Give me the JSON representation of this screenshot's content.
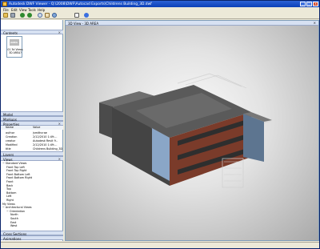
{
  "window": {
    "title": "Autodesk DWF Viewer - Q:\\2008\\DWF\\Autocad Exports\\Childrens Building_3D.dwf",
    "minimize": "_",
    "maximize": "□",
    "close": "x"
  },
  "menu": [
    "File",
    "Edit",
    "View",
    "Tools",
    "Help"
  ],
  "toolbar": {
    "icons": [
      "open-icon",
      "print-icon",
      "back-icon",
      "forward-icon",
      "zoom-icon",
      "pan-icon",
      "orbit-icon",
      "select-icon",
      "help-icon"
    ]
  },
  "contents": {
    "header": "Contents",
    "thumbnail_label": "01 3d Views 3D AREA?",
    "thumbnail_badge": "AREA"
  },
  "sections": {
    "model": "Model",
    "markups": "Markups",
    "properties": "Properties",
    "layers": "Layers",
    "views": "Views",
    "cross_sections": "Cross Sections",
    "animations": "Animations"
  },
  "properties_table": {
    "col_name": "Name",
    "col_value": "Value",
    "rows": [
      {
        "k": "author",
        "v": "jsmithcrae"
      },
      {
        "k": "Creation",
        "v": "2/12/2010 1:49:..."
      },
      {
        "k": "creator",
        "v": "Autodesk Revit 9.."
      },
      {
        "k": "Modified",
        "v": "2/12/2010 1:49:..."
      },
      {
        "k": "title",
        "v": "Childrens Building_3D"
      }
    ]
  },
  "views_tree": [
    {
      "label": "Standard Views",
      "indent": 1,
      "expander": "−"
    },
    {
      "label": "Front Top Left",
      "indent": 2
    },
    {
      "label": "Front Top Right",
      "indent": 2
    },
    {
      "label": "Front Bottom Left",
      "indent": 2
    },
    {
      "label": "Front Bottom Right",
      "indent": 2
    },
    {
      "label": "Front",
      "indent": 2
    },
    {
      "label": "Back",
      "indent": 2
    },
    {
      "label": "Top",
      "indent": 2
    },
    {
      "label": "Bottom",
      "indent": 2
    },
    {
      "label": "Left",
      "indent": 2
    },
    {
      "label": "Right",
      "indent": 2
    },
    {
      "label": "My Views",
      "indent": 1
    },
    {
      "label": "Architectural Views",
      "indent": 1,
      "expander": "−"
    },
    {
      "label": "Orientation",
      "indent": 2,
      "expander": "−"
    },
    {
      "label": "North",
      "indent": 3
    },
    {
      "label": "South",
      "indent": 3
    },
    {
      "label": "East",
      "indent": 3
    },
    {
      "label": "West",
      "indent": 3
    }
  ],
  "viewport": {
    "tab_label": "3D View - 3D AREA"
  },
  "colors": {
    "title_bar": "#1450c8",
    "panel_header": "#d7e1f2",
    "roof": "#5c5c5c",
    "wall_dark": "#3f3f3f",
    "brick": "#7a3b2a",
    "glass": "#8aa6c7"
  }
}
